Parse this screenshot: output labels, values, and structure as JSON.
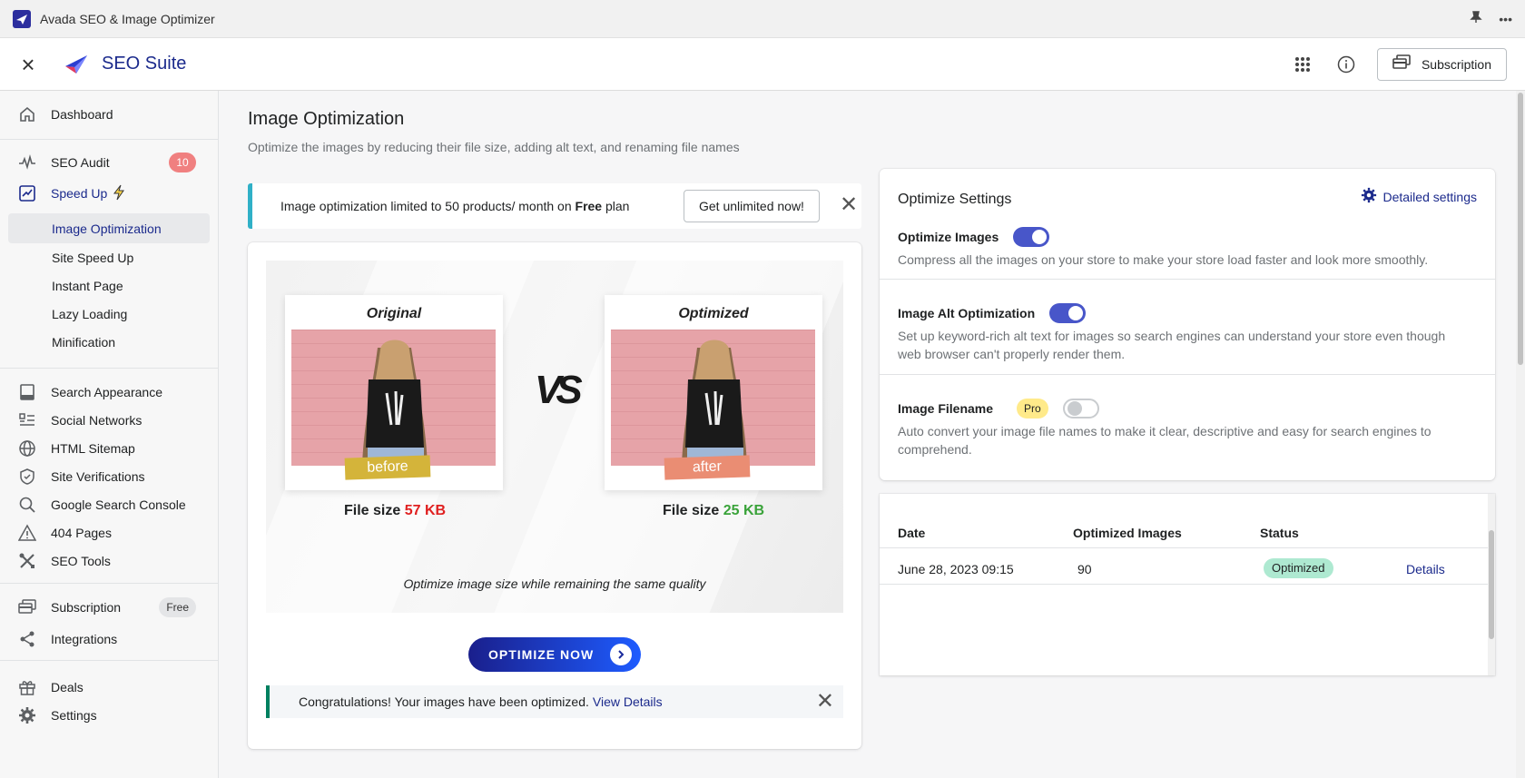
{
  "window": {
    "title": "Avada SEO & Image Optimizer"
  },
  "header": {
    "brand": "SEO Suite",
    "subscription_label": "Subscription"
  },
  "sidebar": {
    "dashboard": "Dashboard",
    "seo_audit": "SEO Audit",
    "seo_audit_badge": "10",
    "speed_up": "Speed Up",
    "speed_up_items": [
      "Image Optimization",
      "Site Speed Up",
      "Instant Page",
      "Lazy Loading",
      "Minification"
    ],
    "search_appearance": "Search Appearance",
    "social_networks": "Social Networks",
    "html_sitemap": "HTML Sitemap",
    "site_verifications": "Site Verifications",
    "google_search_console": "Google Search Console",
    "pages_404": "404 Pages",
    "seo_tools": "SEO Tools",
    "subscription": "Subscription",
    "subscription_badge": "Free",
    "integrations": "Integrations",
    "deals": "Deals",
    "settings": "Settings"
  },
  "main": {
    "title": "Image Optimization",
    "subtitle": "Optimize the images by reducing their file size, adding alt text, and renaming file names",
    "banner": {
      "text_before": "Image optimization limited to 50 products/ month on ",
      "plan": "Free",
      "text_after": " plan",
      "cta": "Get unlimited now!"
    },
    "compare": {
      "original_caption": "Original",
      "optimized_caption": "Optimized",
      "before_tag": "before",
      "after_tag": "after",
      "vs": "VS",
      "file_size_label": "File size",
      "original_size": "57 KB",
      "optimized_size": "25 KB",
      "note": "Optimize image size while remaining the same quality"
    },
    "optimize_button": "OPTIMIZE NOW",
    "success": {
      "text": "Congratulations! Your images have been optimized.",
      "link": "View Details"
    },
    "settings": {
      "title": "Optimize Settings",
      "detailed_link": "Detailed settings",
      "items": [
        {
          "name": "Optimize Images",
          "desc": "Compress all the images on your store to make your store load faster and look more smoothly.",
          "enabled": true
        },
        {
          "name": "Image Alt Optimization",
          "desc": "Set up keyword-rich alt text for images so search engines can understand your store even though web browser can't properly render them.",
          "enabled": true
        },
        {
          "name": "Image Filename",
          "badge": "Pro",
          "desc": "Auto convert your image file names to make it clear, descriptive and easy for search engines to comprehend.",
          "enabled": false
        }
      ]
    },
    "history": {
      "headers": [
        "Date",
        "Optimized Images",
        "Status"
      ],
      "rows": [
        {
          "date": "June 28, 2023 09:15",
          "count": "90",
          "status": "Optimized",
          "action": "Details"
        }
      ]
    }
  },
  "colors": {
    "brand": "#1b2a8c",
    "toggle_on": "#4856c9",
    "original_size": "#e02020",
    "optimized_size": "#3aa33a",
    "before_tag": "#d4b43a",
    "after_tag": "#ea8d73"
  }
}
